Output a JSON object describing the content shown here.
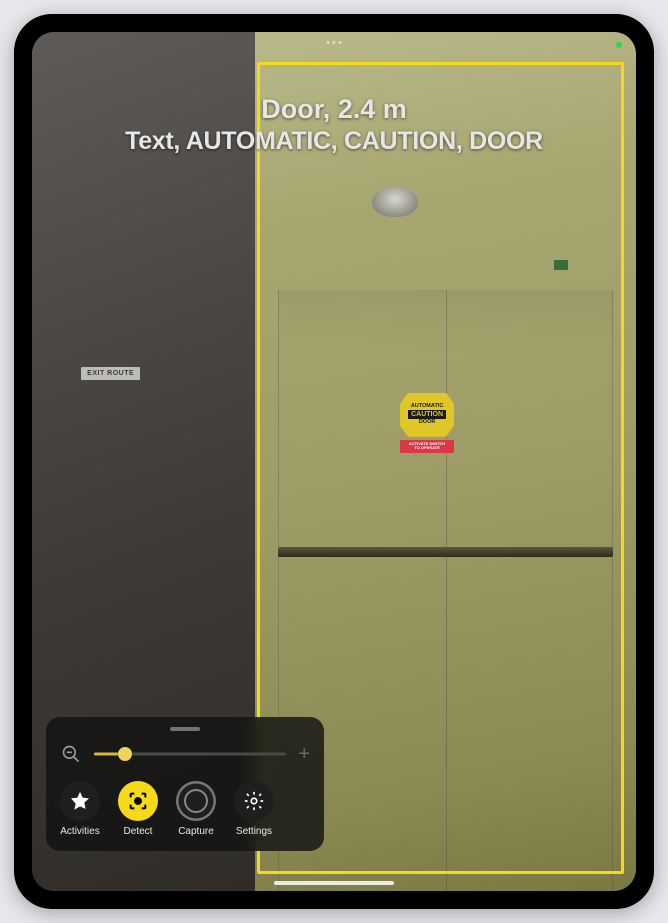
{
  "detection": {
    "line1": "Door, 2.4 m",
    "line2": "Text, AUTOMATIC, CAUTION, DOOR",
    "highlight_color": "#f5d91a"
  },
  "scene_text": {
    "exit_route": "EXIT ROUTE",
    "caution_top": "AUTOMATIC",
    "caution_mid": "CAUTION",
    "caution_bottom": "DOOR",
    "caution_sub1": "ACTIVATE SWITCH",
    "caution_sub2": "TO OPERATE"
  },
  "controls": {
    "zoom_value_pct": 16,
    "buttons": [
      {
        "id": "activities",
        "label": "Activities",
        "selected": false
      },
      {
        "id": "detect",
        "label": "Detect",
        "selected": true
      },
      {
        "id": "capture",
        "label": "Capture",
        "selected": false
      },
      {
        "id": "settings",
        "label": "Settings",
        "selected": false
      }
    ]
  },
  "accent_color": "#f5d91a"
}
